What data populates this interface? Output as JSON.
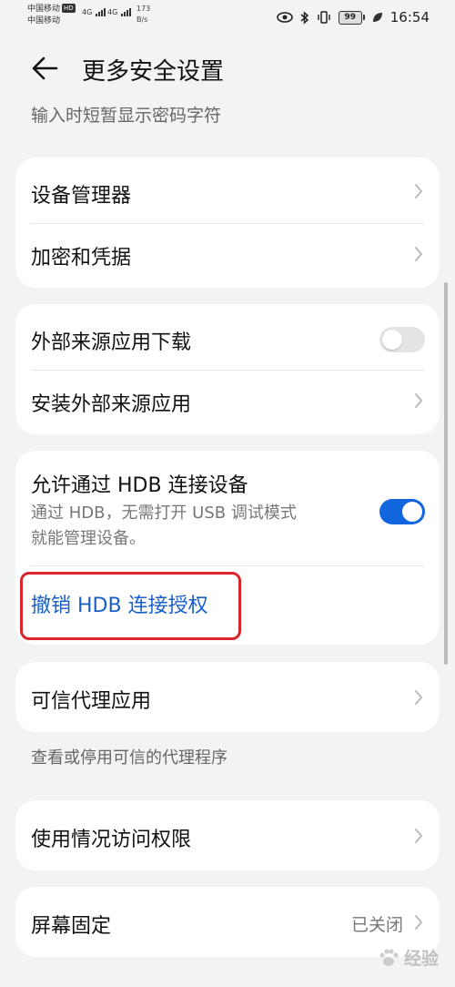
{
  "status_bar": {
    "carrier1": "中国移动",
    "carrier1_badge": "HD",
    "carrier2": "中国移动",
    "network1": "4G",
    "network2": "4G",
    "speed_value": "173",
    "speed_unit": "B/s",
    "battery": "99",
    "time": "16:54"
  },
  "header": {
    "title": "更多安全设置"
  },
  "subtitle": "输入时短暂显示密码字符",
  "group1": {
    "device_manager": "设备管理器",
    "encryption": "加密和凭据"
  },
  "group2": {
    "external_download": "外部来源应用下载",
    "external_download_enabled": false,
    "install_external": "安装外部来源应用"
  },
  "group3": {
    "hdb_title": "允许通过 HDB 连接设备",
    "hdb_desc_line1": "通过 HDB，无需打开 USB 调试模式",
    "hdb_desc_line2": "就能管理设备。",
    "hdb_enabled": true,
    "revoke_hdb": "撤销 HDB 连接授权"
  },
  "group4": {
    "trusted_agents": "可信代理应用"
  },
  "trusted_note": "查看或停用可信的代理程序",
  "group5": {
    "usage_access": "使用情况访问权限"
  },
  "group6": {
    "screen_pinning": "屏幕固定",
    "screen_pinning_value": "已关闭"
  },
  "watermark": {
    "text": "经验"
  },
  "colors": {
    "accent": "#1166e0",
    "link": "#1a5fc8",
    "highlight": "#d9262c",
    "background": "#f1f3f5"
  }
}
